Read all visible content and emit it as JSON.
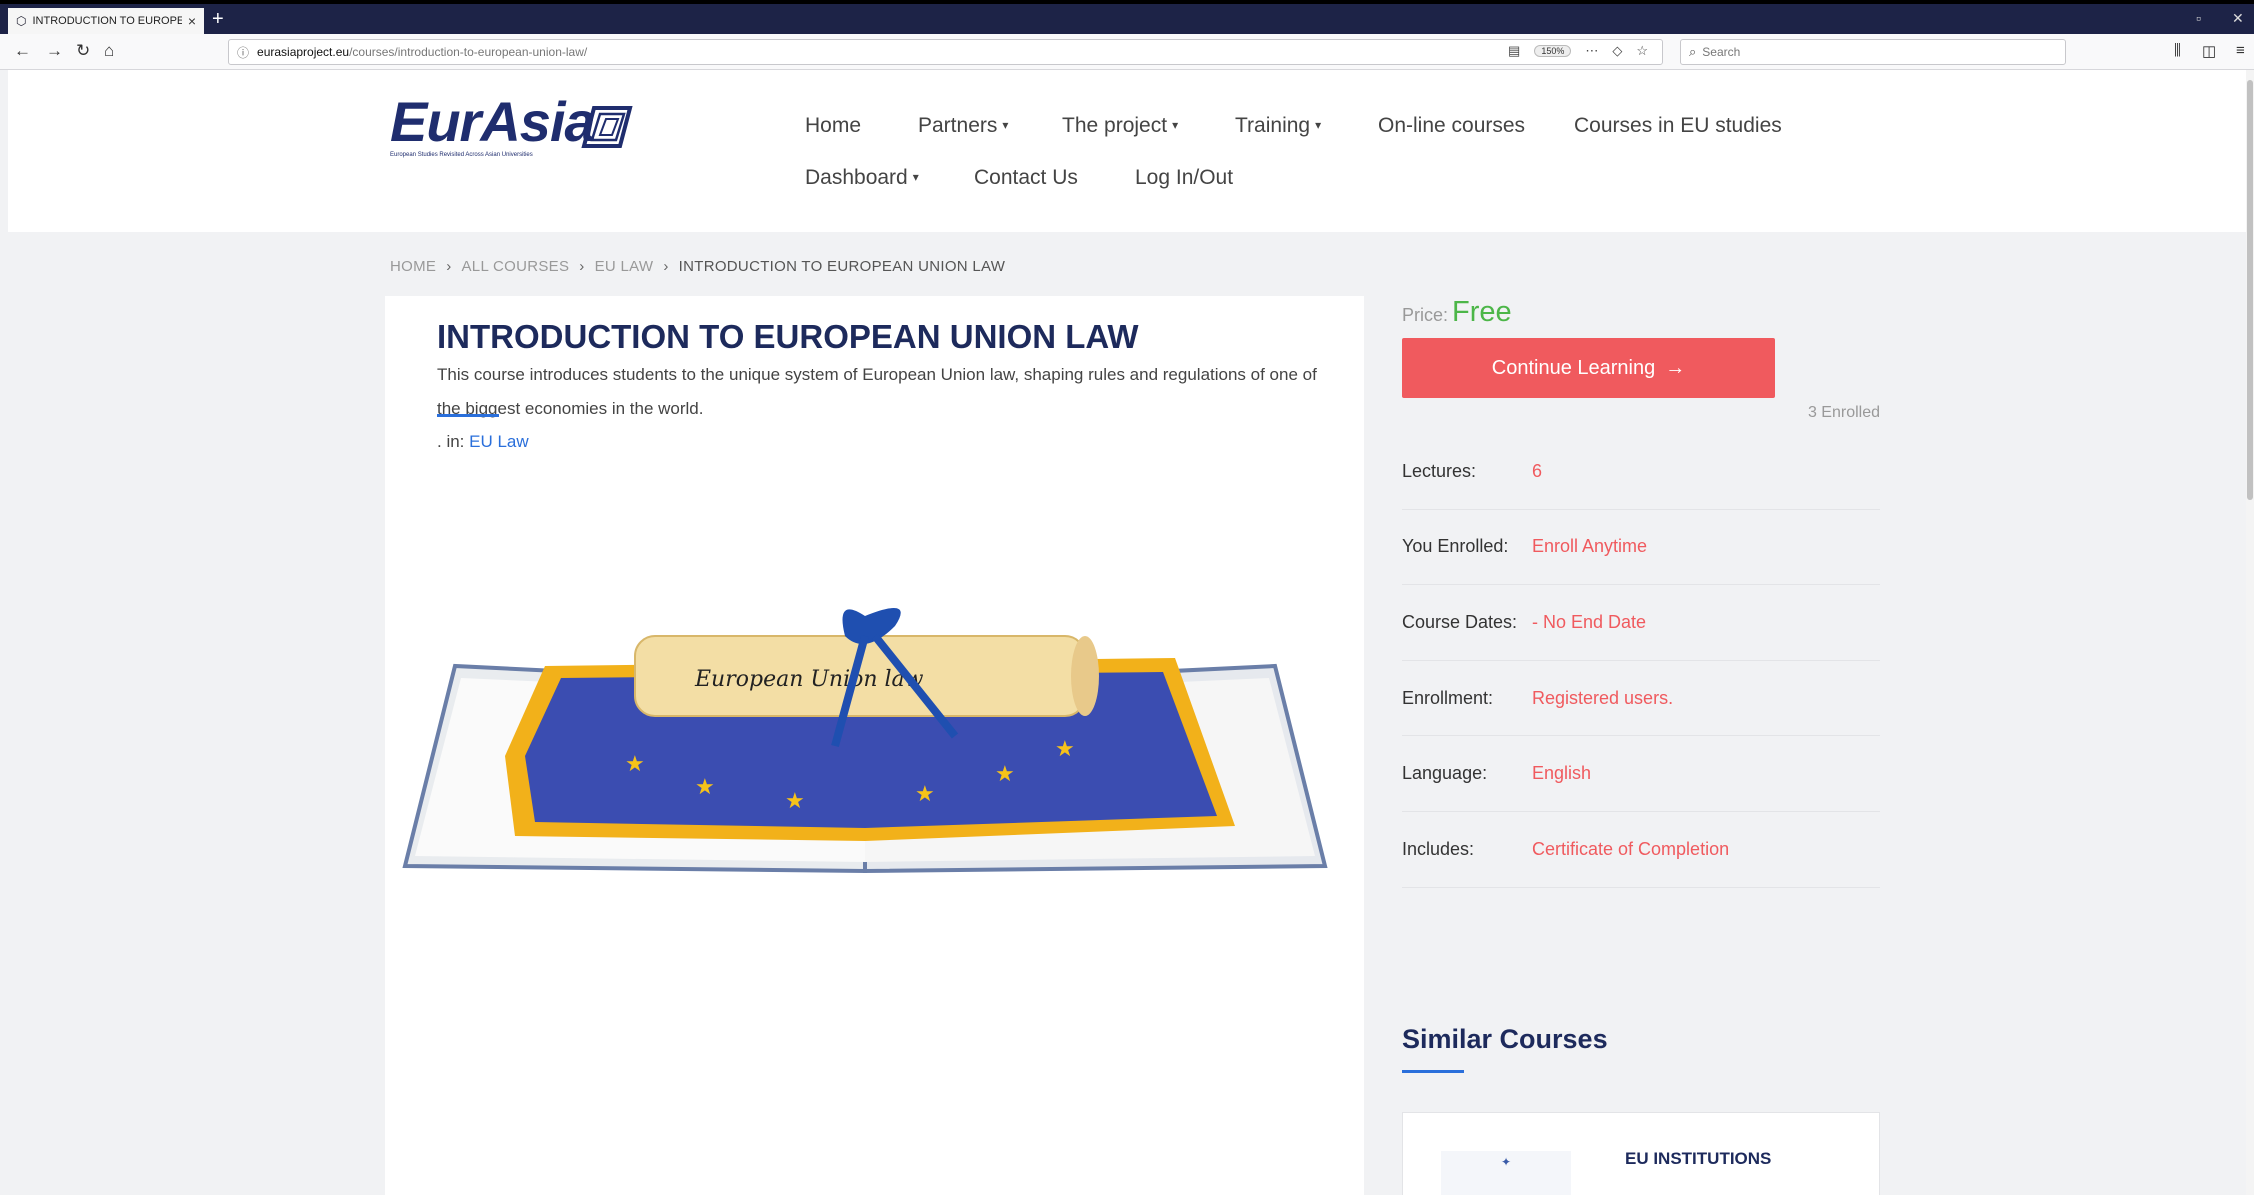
{
  "browser": {
    "tab_title": "INTRODUCTION TO EUROPEAN",
    "tab_close": "×",
    "new_tab": "+",
    "url_domain": "eurasiaproject.eu",
    "url_path": "/courses/introduction-to-european-union-law/",
    "zoom": "150%",
    "search_placeholder": "Search"
  },
  "site": {
    "logo_text": "EurAsia",
    "logo_tagline": "European Studies Revisited Across Asian Universities",
    "nav": {
      "home": "Home",
      "partners": "Partners",
      "project": "The project",
      "training": "Training",
      "online": "On-line courses",
      "eu_courses": "Courses in EU studies",
      "dashboard": "Dashboard",
      "contact": "Contact Us",
      "login": "Log In/Out"
    },
    "breadcrumb": {
      "home": "HOME",
      "all": "ALL COURSES",
      "cat": "EU LAW",
      "current": "INTRODUCTION TO EUROPEAN UNION LAW"
    }
  },
  "course": {
    "title": "INTRODUCTION TO EUROPEAN UNION LAW",
    "description": "This course introduces students to the unique system of European Union law, shaping rules and regulations of one of the biggest economies in the world.",
    "category_prefix": ". in: ",
    "category": "EU Law",
    "scroll_text": "European Union law"
  },
  "sidebar": {
    "price_label": "Price:",
    "price_value": "Free",
    "cta_label": "Continue Learning",
    "enrolled": "3 Enrolled",
    "info": [
      {
        "key": "Lectures:",
        "value": "6"
      },
      {
        "key": "You Enrolled:",
        "value": "Enroll Anytime"
      },
      {
        "key": "Course Dates:",
        "value": "- No End Date"
      },
      {
        "key": "Enrollment:",
        "value": "Registered users."
      },
      {
        "key": "Language:",
        "value": "English"
      },
      {
        "key": "Includes:",
        "value": "Certificate of Completion"
      }
    ],
    "similar_heading": "Similar Courses",
    "similar_course_title": "EU INSTITUTIONS"
  },
  "colors": {
    "accent": "#f05a5e",
    "link": "#2a6fdb",
    "navy": "#1d2a5c",
    "free": "#4cb648"
  }
}
